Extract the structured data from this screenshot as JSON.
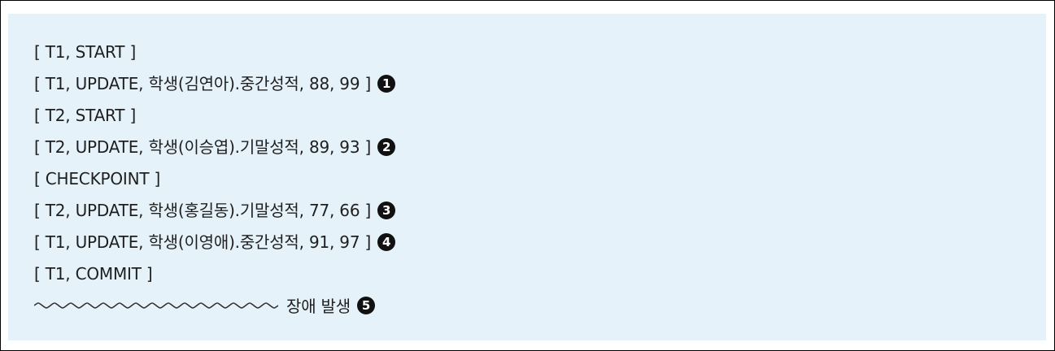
{
  "log": {
    "lines": [
      {
        "text": "[ T1, START ]",
        "marker": ""
      },
      {
        "text": "[ T1, UPDATE, 학생(김연아).중간성적, 88, 99 ]",
        "marker": "1"
      },
      {
        "text": "[ T2, START ]",
        "marker": ""
      },
      {
        "text": "[ T2, UPDATE, 학생(이승엽).기말성적, 89, 93 ]",
        "marker": "2"
      },
      {
        "text": "[ CHECKPOINT ]",
        "marker": ""
      },
      {
        "text": "[ T2, UPDATE, 학생(홍길동).기말성적, 77, 66 ]",
        "marker": "3"
      },
      {
        "text": "[ T1, UPDATE, 학생(이영애).중간성적, 91, 97 ]",
        "marker": "4"
      },
      {
        "text": "[ T1, COMMIT ]",
        "marker": ""
      }
    ],
    "failure": {
      "text": "장애 발생",
      "marker": "5"
    }
  },
  "colors": {
    "panel_background": "#e5f2f9",
    "text": "#1f1f1f",
    "marker_fill": "#111111",
    "frame_border": "#000000"
  }
}
